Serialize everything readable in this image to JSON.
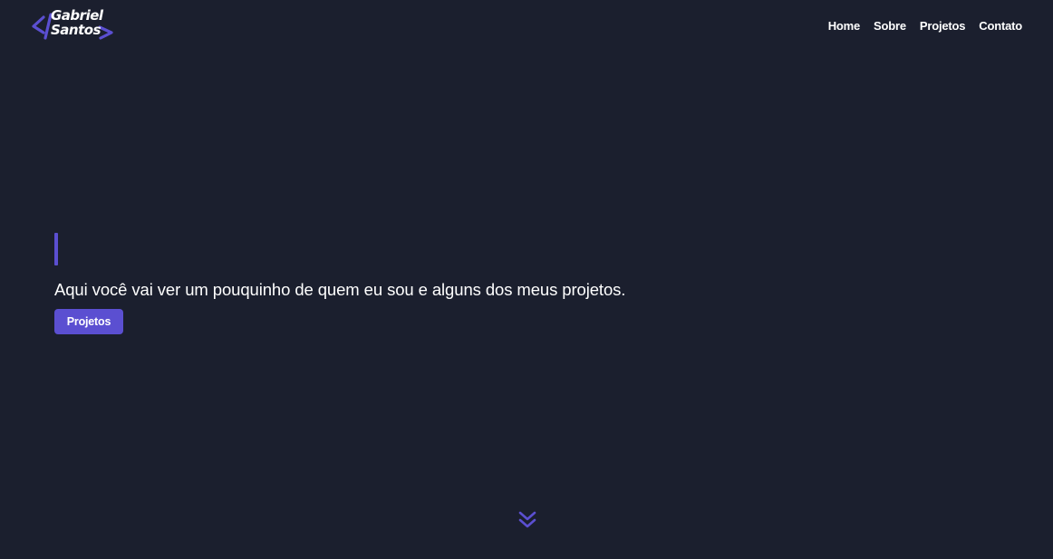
{
  "brand": {
    "line1": "Gabriel",
    "line2": "Santos",
    "open_tag": "</",
    "close_tag": ">",
    "accent_color": "#5b4fd1"
  },
  "nav": {
    "items": [
      {
        "label": "Home"
      },
      {
        "label": "Sobre"
      },
      {
        "label": "Projetos"
      },
      {
        "label": "Contato"
      }
    ]
  },
  "hero": {
    "subtitle": "Aqui você vai ver um pouquinho de quem eu sou e alguns dos meus projetos.",
    "cta_label": "Projetos"
  },
  "scroll_indicator": {
    "icon": "double-chevron-down-icon"
  },
  "colors": {
    "background": "#1b1f2e",
    "accent": "#5b4fd1",
    "text": "#ffffff"
  }
}
